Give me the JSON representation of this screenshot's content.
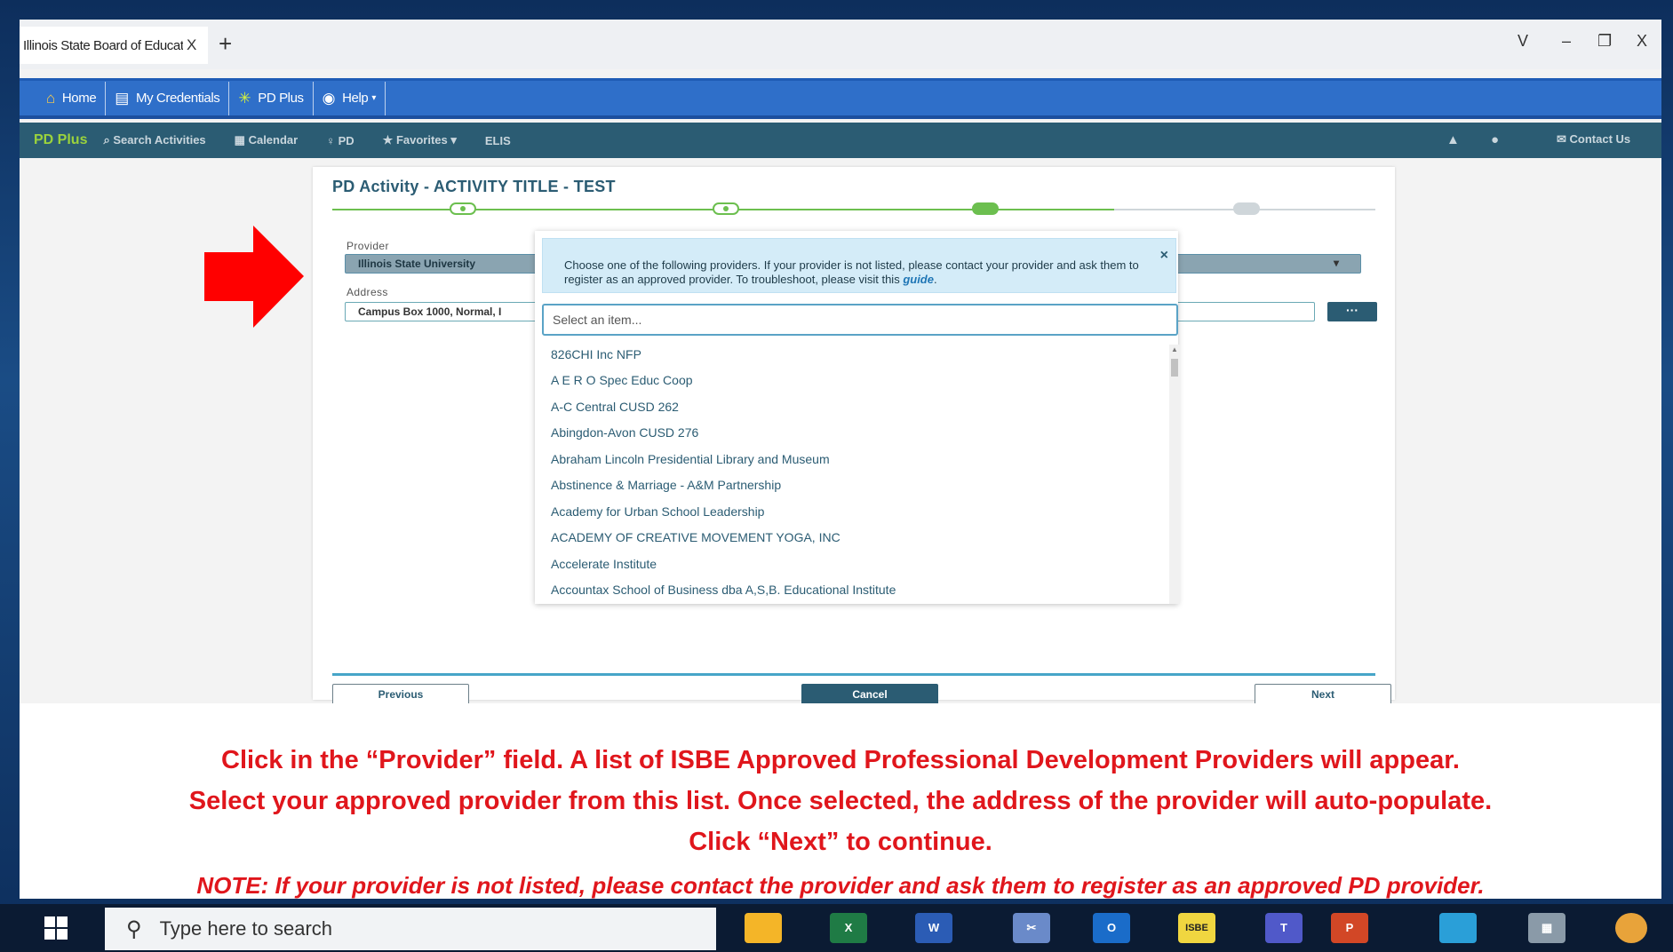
{
  "browser": {
    "tab_title": "Illinois State Board of Education",
    "tab_close": "X",
    "new_tab": "+",
    "win_min": "–",
    "win_restore": "❐",
    "win_close": "X",
    "win_dropdown": "V"
  },
  "credbar": {
    "home": "Home",
    "credentials": "My Credentials",
    "pdplus": "PD Plus",
    "help": "Help"
  },
  "pdnav": {
    "brand": "PD Plus",
    "search": "Search Activities",
    "calendar": "Calendar",
    "pd": "PD",
    "favorites": "Favorites",
    "elis": "ELIS",
    "contact": "Contact Us"
  },
  "card": {
    "title": "PD Activity - ACTIVITY TITLE - TEST",
    "provider_label": "Provider",
    "provider_value": "Illinois State University",
    "address_label": "Address",
    "address_value": "Campus Box 1000, Normal, I",
    "more_label": "···",
    "previous": "Previous",
    "cancel": "Cancel",
    "next": "Next"
  },
  "dropdown": {
    "info_text": "Choose one of the following providers. If your provider is not listed, please contact your provider and ask them to register as an approved provider. To troubleshoot, please visit this ",
    "info_link": "guide",
    "info_after": ".",
    "close": "×",
    "search_placeholder": "Select an item...",
    "items": [
      "826CHI Inc NFP",
      "A E R O Spec Educ Coop",
      "A-C Central CUSD 262",
      "Abingdon-Avon CUSD 276",
      "Abraham Lincoln Presidential Library and Museum",
      "Abstinence & Marriage - A&M Partnership",
      "Academy for Urban School Leadership",
      "ACADEMY OF CREATIVE MOVEMENT YOGA, INC",
      "Accelerate Institute",
      "Accountax School of Business dba A,S,B. Educational Institute"
    ]
  },
  "instructions": {
    "line1": "Click in the “Provider” field.  A list of ISBE Approved Professional Development Providers will appear.",
    "line2": "Select your approved provider from this list. Once selected, the address of the provider will auto-populate.",
    "line3": "Click “Next” to continue.",
    "note": "NOTE: If your provider is not listed, please contact the provider and ask them to register as an approved PD provider."
  },
  "taskbar": {
    "search_text": "Type here to search",
    "isbe_label": "ISBE"
  },
  "colors": {
    "accent": "#2b5c73",
    "stepper_done": "#6cbf4f",
    "instruction_red": "#e0161c",
    "credbar_blue": "#2f6fc9"
  }
}
